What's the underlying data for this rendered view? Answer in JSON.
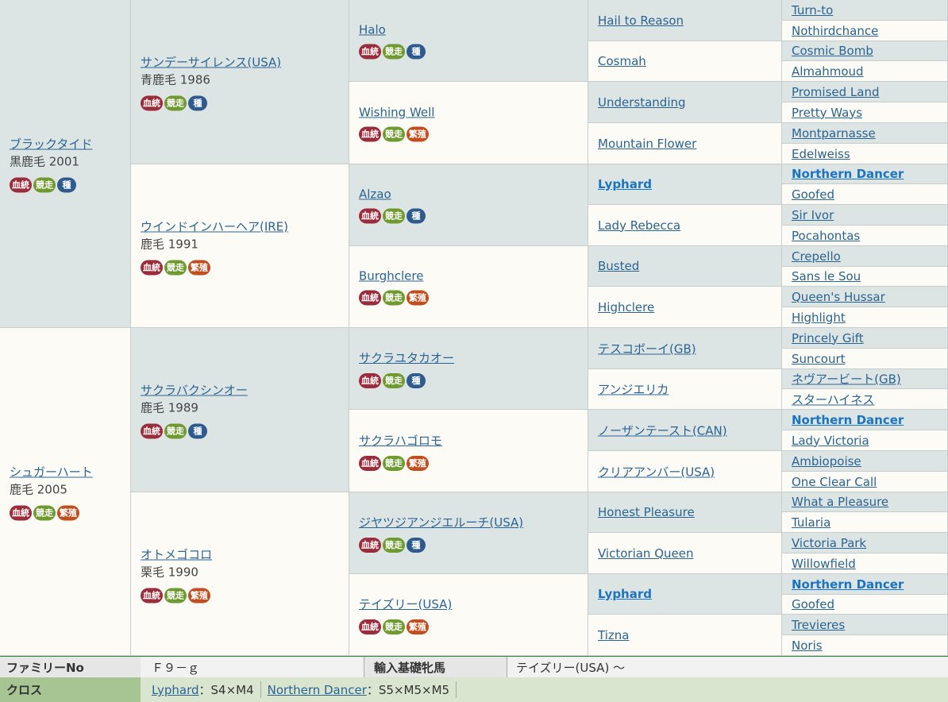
{
  "badge_labels": {
    "bloodline": "血統",
    "racing": "競走",
    "stallion": "種",
    "broodmare": "繁殖"
  },
  "gen1": [
    {
      "name": "ブラックタイド",
      "coat": "黒鹿毛 2001",
      "badges": [
        "bloodline",
        "racing",
        "stallion"
      ]
    },
    {
      "name": "シュガーハート",
      "coat": "鹿毛 2005",
      "badges": [
        "bloodline",
        "racing",
        "broodmare"
      ]
    }
  ],
  "gen2": [
    {
      "name": "サンデーサイレンス(USA)",
      "coat": "青鹿毛 1986",
      "badges": [
        "bloodline",
        "racing",
        "stallion"
      ]
    },
    {
      "name": "ウインドインハーヘア(IRE)",
      "coat": "鹿毛 1991",
      "badges": [
        "bloodline",
        "racing",
        "broodmare"
      ]
    },
    {
      "name": "サクラバクシンオー",
      "coat": "鹿毛 1989",
      "badges": [
        "bloodline",
        "racing",
        "stallion"
      ]
    },
    {
      "name": "オトメゴコロ",
      "coat": "栗毛 1990",
      "badges": [
        "bloodline",
        "racing",
        "broodmare"
      ]
    }
  ],
  "gen3": [
    {
      "name": "Halo",
      "badges": [
        "bloodline",
        "racing",
        "stallion"
      ]
    },
    {
      "name": "Wishing Well",
      "badges": [
        "bloodline",
        "racing",
        "broodmare"
      ]
    },
    {
      "name": "Alzao",
      "badges": [
        "bloodline",
        "racing",
        "stallion"
      ]
    },
    {
      "name": "Burghclere",
      "badges": [
        "bloodline",
        "racing",
        "broodmare"
      ]
    },
    {
      "name": "サクラユタカオー",
      "badges": [
        "bloodline",
        "racing",
        "stallion"
      ]
    },
    {
      "name": "サクラハゴロモ",
      "badges": [
        "bloodline",
        "racing",
        "broodmare"
      ]
    },
    {
      "name": "ジヤツジアンジエルーチ(USA)",
      "badges": [
        "bloodline",
        "racing",
        "stallion"
      ]
    },
    {
      "name": "テイズリー(USA)",
      "badges": [
        "bloodline",
        "racing",
        "broodmare"
      ]
    }
  ],
  "gen4": [
    {
      "name": "Hail to Reason",
      "bold": false
    },
    {
      "name": "Cosmah",
      "bold": false
    },
    {
      "name": "Understanding",
      "bold": false
    },
    {
      "name": "Mountain Flower",
      "bold": false
    },
    {
      "name": "Lyphard",
      "bold": true
    },
    {
      "name": "Lady Rebecca",
      "bold": false
    },
    {
      "name": "Busted",
      "bold": false
    },
    {
      "name": "Highclere",
      "bold": false
    },
    {
      "name": "テスコボーイ(GB)",
      "bold": false
    },
    {
      "name": "アンジエリカ",
      "bold": false
    },
    {
      "name": "ノーザンテースト(CAN)",
      "bold": false
    },
    {
      "name": "クリアアンバー(USA)",
      "bold": false
    },
    {
      "name": "Honest Pleasure",
      "bold": false
    },
    {
      "name": "Victorian Queen",
      "bold": false
    },
    {
      "name": "Lyphard",
      "bold": true
    },
    {
      "name": "Tizna",
      "bold": false
    }
  ],
  "gen5": [
    {
      "name": "Turn-to",
      "bold": false
    },
    {
      "name": "Nothirdchance",
      "bold": false
    },
    {
      "name": "Cosmic Bomb",
      "bold": false
    },
    {
      "name": "Almahmoud",
      "bold": false
    },
    {
      "name": "Promised Land",
      "bold": false
    },
    {
      "name": "Pretty Ways",
      "bold": false
    },
    {
      "name": "Montparnasse",
      "bold": false
    },
    {
      "name": "Edelweiss",
      "bold": false
    },
    {
      "name": "Northern Dancer",
      "bold": true
    },
    {
      "name": "Goofed",
      "bold": false
    },
    {
      "name": "Sir Ivor",
      "bold": false
    },
    {
      "name": "Pocahontas",
      "bold": false
    },
    {
      "name": "Crepello",
      "bold": false
    },
    {
      "name": "Sans le Sou",
      "bold": false
    },
    {
      "name": "Queen's Hussar",
      "bold": false
    },
    {
      "name": "Highlight",
      "bold": false
    },
    {
      "name": "Princely Gift",
      "bold": false
    },
    {
      "name": "Suncourt",
      "bold": false
    },
    {
      "name": "ネヴアービート(GB)",
      "bold": false
    },
    {
      "name": "スターハイネス",
      "bold": false
    },
    {
      "name": "Northern Dancer",
      "bold": true
    },
    {
      "name": "Lady Victoria",
      "bold": false
    },
    {
      "name": "Ambiopoise",
      "bold": false
    },
    {
      "name": "One Clear Call",
      "bold": false
    },
    {
      "name": "What a Pleasure",
      "bold": false
    },
    {
      "name": "Tularia",
      "bold": false
    },
    {
      "name": "Victoria Park",
      "bold": false
    },
    {
      "name": "Willowfield",
      "bold": false
    },
    {
      "name": "Northern Dancer",
      "bold": true
    },
    {
      "name": "Goofed",
      "bold": false
    },
    {
      "name": "Trevieres",
      "bold": false
    },
    {
      "name": "Noris",
      "bold": false
    }
  ],
  "info": {
    "family_label": "ファミリーNo",
    "family_value": "Ｆ９－ｇ",
    "foundation_label": "輸入基礎牝馬",
    "foundation_value": "テイズリー(USA) ～",
    "cross_label": "クロス",
    "crosses": [
      {
        "name": "Lyphard",
        "value": "：S4×M4"
      },
      {
        "name": "Northern Dancer",
        "value": "：S5×M5×M5"
      }
    ]
  }
}
